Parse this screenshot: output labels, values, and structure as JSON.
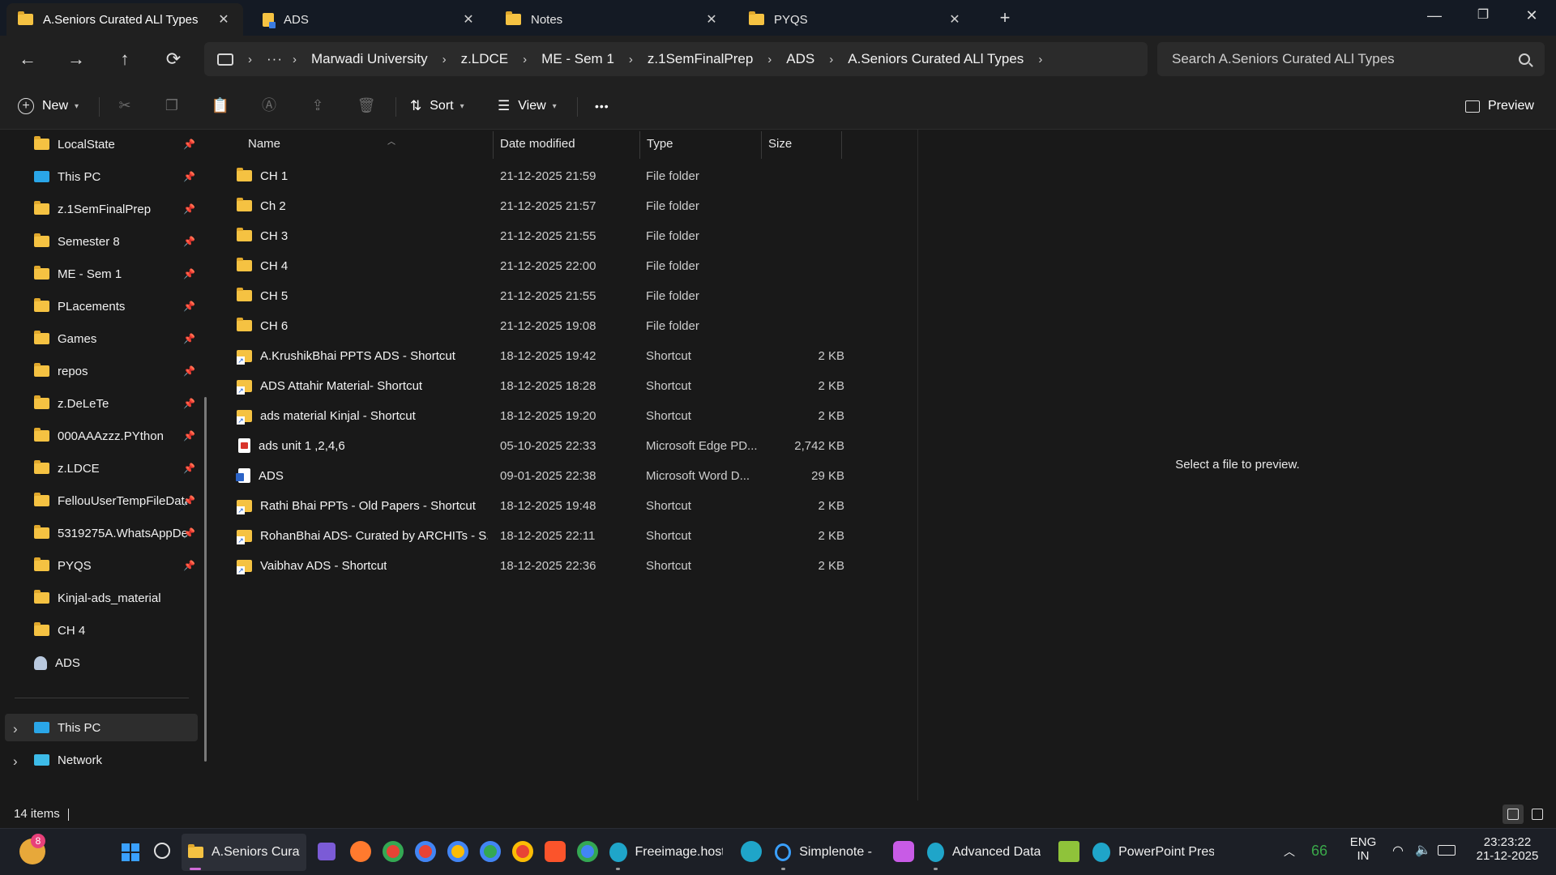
{
  "tabs": [
    {
      "label": "A.Seniors Curated ALl  Types",
      "icon": "folder-icon",
      "active": true
    },
    {
      "label": "ADS",
      "icon": "document-icon",
      "active": false
    },
    {
      "label": "Notes",
      "icon": "folder-icon",
      "active": false
    },
    {
      "label": "PYQS",
      "icon": "folder-icon",
      "active": false
    }
  ],
  "window_controls": {
    "minimize": "—",
    "maximize": "❐",
    "close": "✕"
  },
  "nav": {
    "back": "←",
    "forward": "→",
    "up": "↑",
    "refresh": "⟳"
  },
  "breadcrumb": {
    "overflow": "···",
    "items": [
      "Marwadi University",
      "z.LDCE",
      "ME - Sem 1",
      "z.1SemFinalPrep",
      "ADS",
      "A.Seniors Curated ALl  Types"
    ],
    "separator": "›"
  },
  "search": {
    "placeholder": "Search A.Seniors Curated ALl  Types"
  },
  "commandbar": {
    "new_label": "New",
    "sort_label": "Sort",
    "view_label": "View",
    "more_label": "•••",
    "preview_label": "Preview",
    "icons": [
      "cut-icon",
      "copy-icon",
      "paste-icon",
      "rename-icon",
      "share-icon",
      "delete-icon"
    ]
  },
  "sidebar": {
    "quick_access": [
      {
        "label": "LocalState",
        "icon": "folder-icon",
        "pinned": true
      },
      {
        "label": "This PC",
        "icon": "pc-icon",
        "pinned": true
      },
      {
        "label": "z.1SemFinalPrep",
        "icon": "folder-icon",
        "pinned": true
      },
      {
        "label": "Semester 8",
        "icon": "folder-icon",
        "pinned": true
      },
      {
        "label": "ME - Sem 1",
        "icon": "folder-icon",
        "pinned": true
      },
      {
        "label": "PLacements",
        "icon": "folder-icon",
        "pinned": true
      },
      {
        "label": "Games",
        "icon": "folder-icon",
        "pinned": true
      },
      {
        "label": "repos",
        "icon": "folder-icon",
        "pinned": true
      },
      {
        "label": "z.DeLeTe",
        "icon": "folder-icon",
        "pinned": true
      },
      {
        "label": "000AAAzzz.PYthon",
        "icon": "folder-icon",
        "pinned": true
      },
      {
        "label": "z.LDCE",
        "icon": "folder-icon",
        "pinned": true
      },
      {
        "label": "FellouUserTempFileData",
        "icon": "folder-icon",
        "pinned": true
      },
      {
        "label": "5319275A.WhatsAppDe",
        "icon": "folder-icon",
        "pinned": true
      },
      {
        "label": "PYQS",
        "icon": "folder-icon",
        "pinned": true
      },
      {
        "label": "Kinjal-ads_material",
        "icon": "folder-icon",
        "pinned": false
      },
      {
        "label": "CH 4",
        "icon": "folder-icon",
        "pinned": false
      },
      {
        "label": "ADS",
        "icon": "user-icon",
        "pinned": false
      }
    ],
    "roots": [
      {
        "label": "This PC",
        "icon": "pc-icon"
      },
      {
        "label": "Network",
        "icon": "network-icon"
      }
    ]
  },
  "columns": {
    "name": "Name",
    "date": "Date modified",
    "type": "Type",
    "size": "Size"
  },
  "files": [
    {
      "name": "CH 1",
      "date": "21-12-2025 21:59",
      "type": "File folder",
      "size": "",
      "icon": "folder"
    },
    {
      "name": "Ch 2",
      "date": "21-12-2025 21:57",
      "type": "File folder",
      "size": "",
      "icon": "folder"
    },
    {
      "name": "CH 3",
      "date": "21-12-2025 21:55",
      "type": "File folder",
      "size": "",
      "icon": "folder"
    },
    {
      "name": "CH 4",
      "date": "21-12-2025 22:00",
      "type": "File folder",
      "size": "",
      "icon": "folder"
    },
    {
      "name": "CH 5",
      "date": "21-12-2025 21:55",
      "type": "File folder",
      "size": "",
      "icon": "folder"
    },
    {
      "name": "CH 6",
      "date": "21-12-2025 19:08",
      "type": "File folder",
      "size": "",
      "icon": "folder"
    },
    {
      "name": "A.KrushikBhai PPTS ADS - Shortcut",
      "date": "18-12-2025 19:42",
      "type": "Shortcut",
      "size": "2 KB",
      "icon": "shortcut"
    },
    {
      "name": "ADS Attahir Material- Shortcut",
      "date": "18-12-2025 18:28",
      "type": "Shortcut",
      "size": "2 KB",
      "icon": "shortcut"
    },
    {
      "name": "ads material Kinjal - Shortcut",
      "date": "18-12-2025 19:20",
      "type": "Shortcut",
      "size": "2 KB",
      "icon": "shortcut"
    },
    {
      "name": "ads unit 1 ,2,4,6",
      "date": "05-10-2025 22:33",
      "type": "Microsoft Edge PD...",
      "size": "2,742 KB",
      "icon": "pdf"
    },
    {
      "name": "ADS",
      "date": "09-01-2025 22:38",
      "type": "Microsoft Word D...",
      "size": "29 KB",
      "icon": "word"
    },
    {
      "name": "Rathi Bhai PPTs - Old Papers - Shortcut",
      "date": "18-12-2025 19:48",
      "type": "Shortcut",
      "size": "2 KB",
      "icon": "shortcut"
    },
    {
      "name": "RohanBhai ADS- Curated by ARCHITs - S...",
      "date": "18-12-2025 22:11",
      "type": "Shortcut",
      "size": "2 KB",
      "icon": "shortcut"
    },
    {
      "name": "Vaibhav ADS - Shortcut",
      "date": "18-12-2025 22:36",
      "type": "Shortcut",
      "size": "2 KB",
      "icon": "shortcut"
    }
  ],
  "preview": {
    "message": "Select a file to preview."
  },
  "status": {
    "count": "14 items"
  },
  "taskbar": {
    "weather_badge": "8",
    "apps": [
      {
        "label": "A.Seniors Curated",
        "icon": "file-explorer-icon",
        "active": true
      },
      {
        "label": "Freeimage.host -",
        "icon": "edge-icon",
        "active": false
      },
      {
        "label": "Simplenote - C",
        "icon": "simplenote-icon",
        "active": false
      },
      {
        "label": "Advanced Data S",
        "icon": "edge-icon",
        "active": false
      },
      {
        "label": "PowerPoint Prese",
        "icon": "edge-icon",
        "active": false
      }
    ],
    "tray": {
      "battery_num": "66",
      "lang_top": "ENG",
      "lang_bottom": "IN",
      "time": "23:23:22",
      "date": "21-12-2025"
    }
  },
  "colors": {
    "folder": "#f5c242",
    "accent": "#3aa0ff",
    "background": "#191919"
  }
}
